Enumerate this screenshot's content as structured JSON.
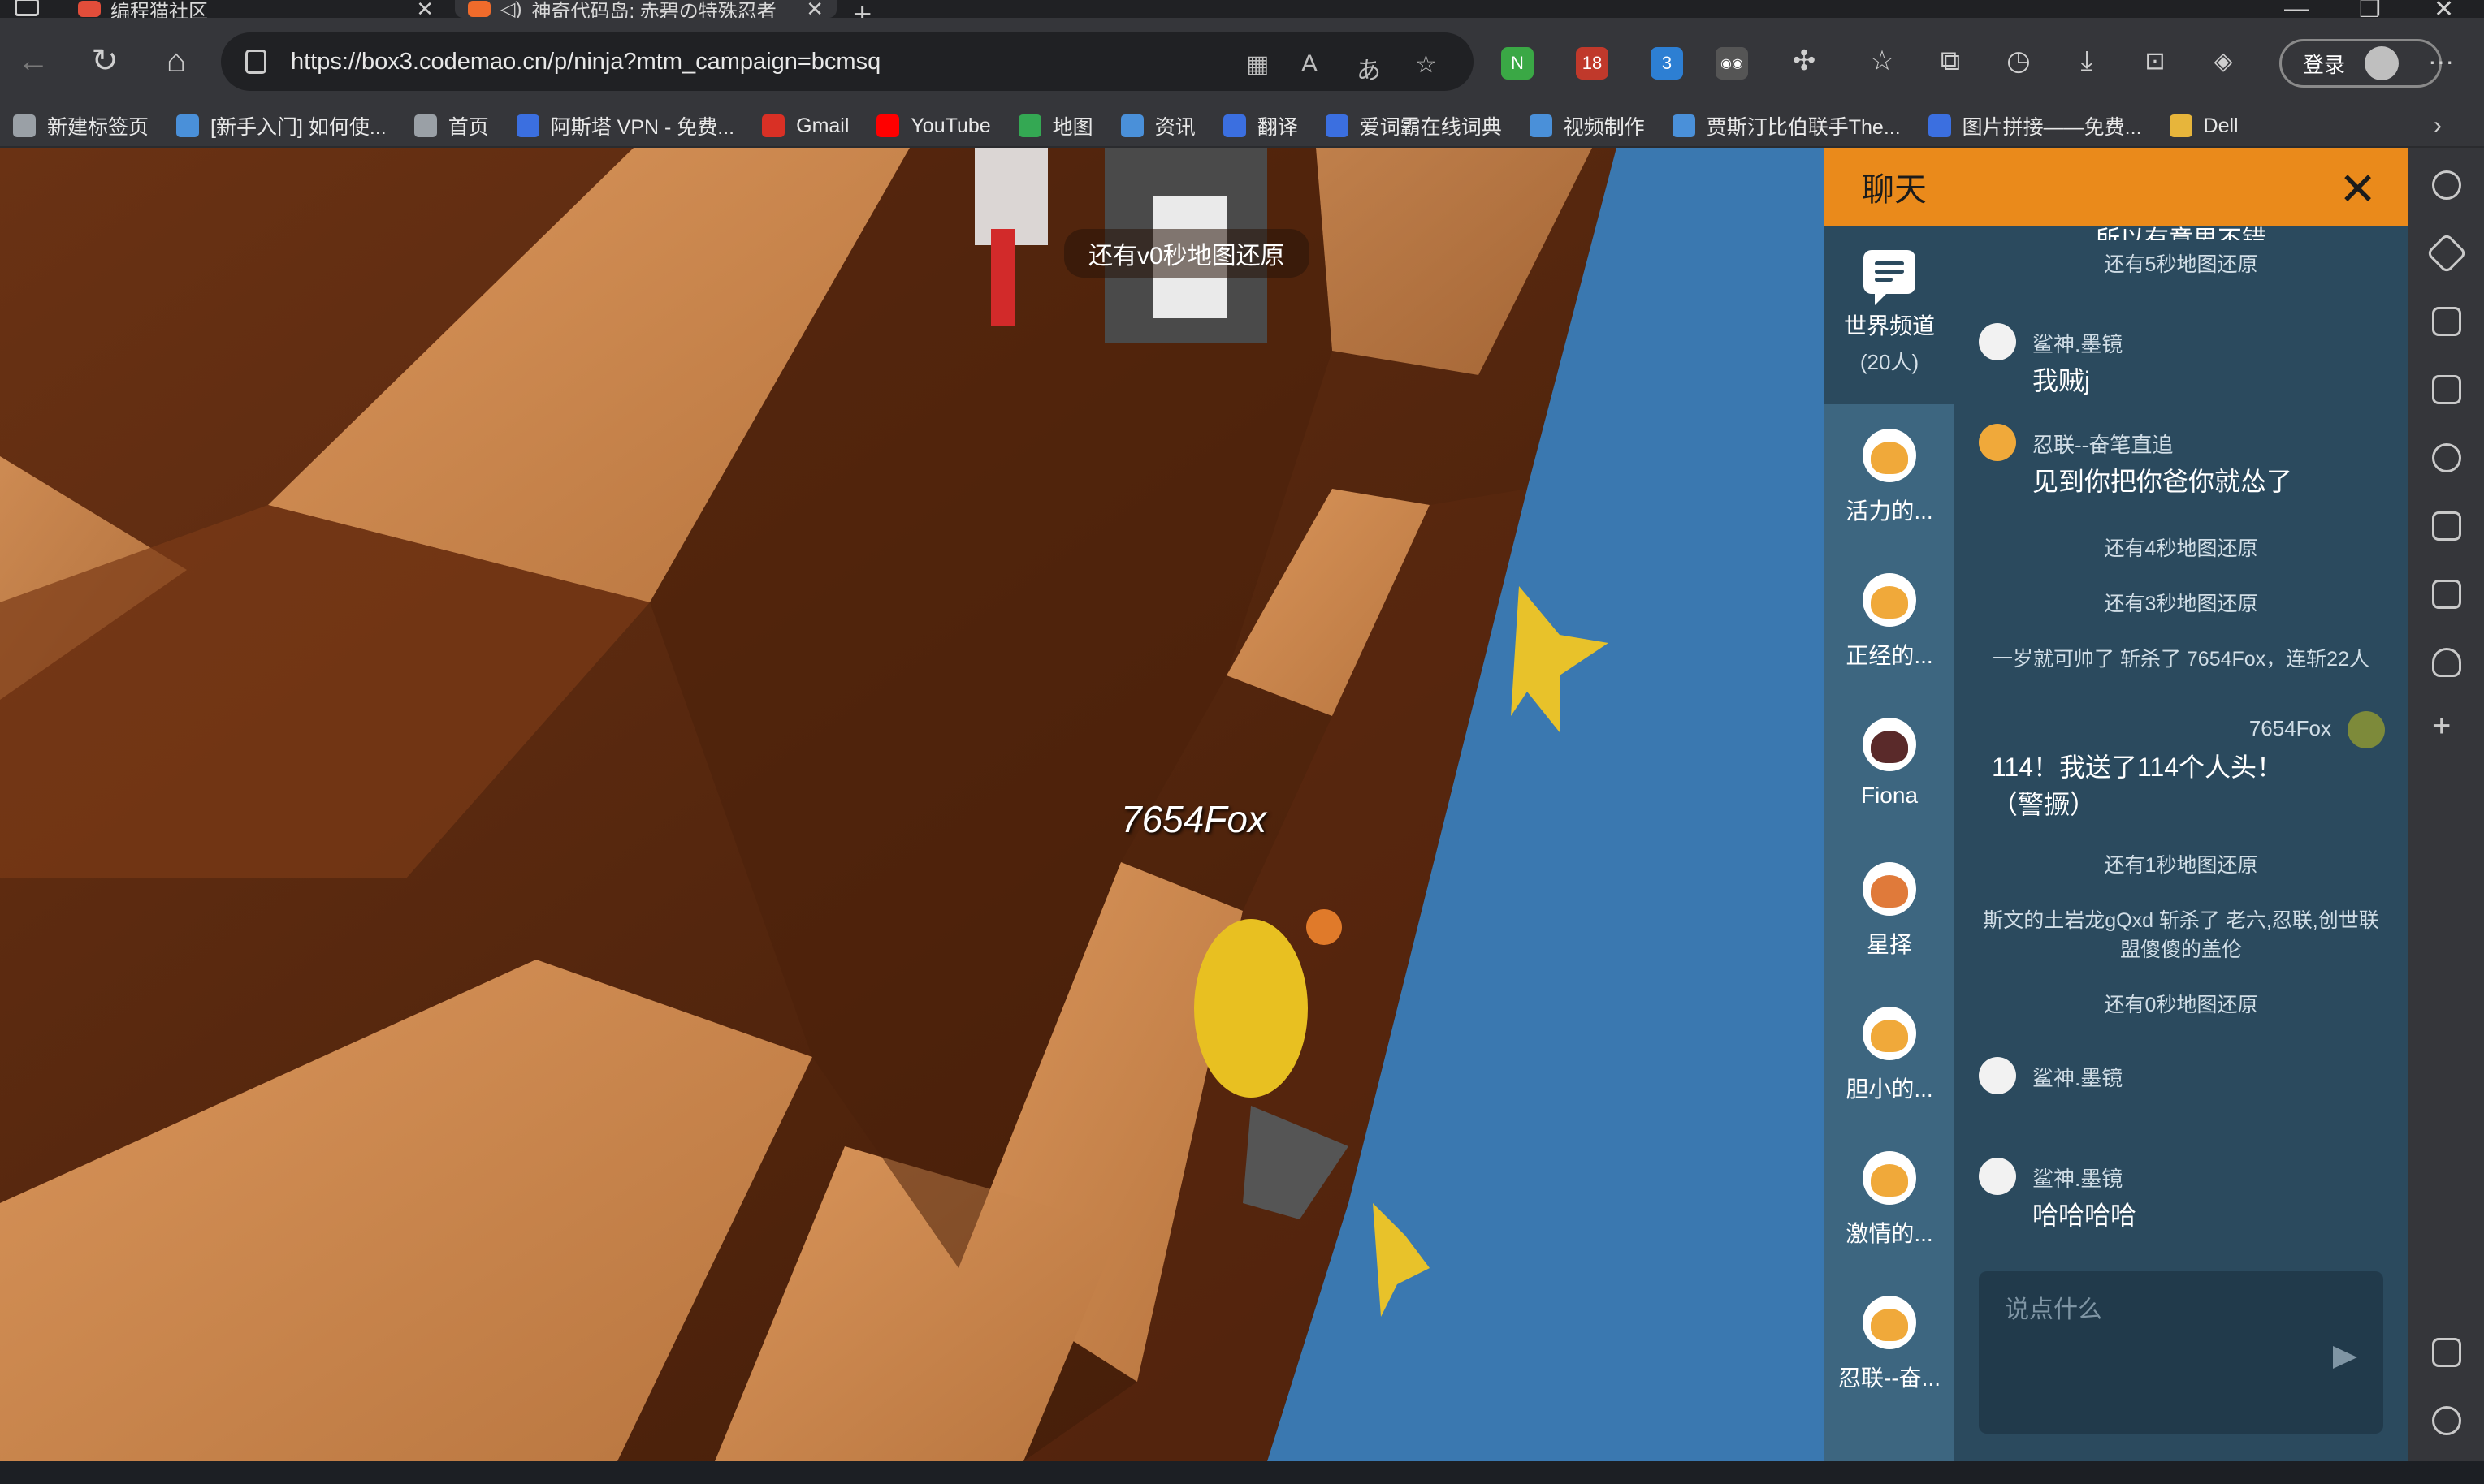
{
  "tabs": [
    {
      "title": "编程猫社区",
      "close": "✕"
    },
    {
      "title": "神奇代码岛: 赤碧の特殊忍者",
      "close": "✕"
    }
  ],
  "new_tab": "+",
  "window_controls": {
    "minimize": "—",
    "restore": "❐",
    "close": "✕"
  },
  "nav": {
    "back": "←",
    "reload": "↻",
    "home": "⌂"
  },
  "address": {
    "url": "https://box3.codemao.cn/p/ninja?mtm_campaign=bcmsq"
  },
  "extensions": [
    {
      "name": "n-extension-icon",
      "label": "N",
      "color": "#3aa845"
    },
    {
      "name": "ublock-icon",
      "label": "18",
      "color": "#c0392b"
    },
    {
      "name": "extension-3-icon",
      "label": "3",
      "color": "#2d7fd3"
    },
    {
      "name": "glasses-icon",
      "label": "◉◉",
      "color": "#555555"
    }
  ],
  "account": {
    "login_label": "登录",
    "more": "···"
  },
  "bookmarks": [
    {
      "label": "新建标签页",
      "color": "#9aa0a6"
    },
    {
      "label": "[新手入门] 如何使...",
      "color": "#4a90d9"
    },
    {
      "label": "首页",
      "color": "#9aa0a6"
    },
    {
      "label": "阿斯塔 VPN - 免费...",
      "color": "#3b6fe0"
    },
    {
      "label": "Gmail",
      "color": "#d93025"
    },
    {
      "label": "YouTube",
      "color": "#ff0000"
    },
    {
      "label": "地图",
      "color": "#34a853"
    },
    {
      "label": "资讯",
      "color": "#4a90d9"
    },
    {
      "label": "翻译",
      "color": "#3b6fe0"
    },
    {
      "label": "爱词霸在线词典",
      "color": "#3b6fe0"
    },
    {
      "label": "视频制作",
      "color": "#4a90d9"
    },
    {
      "label": "贾斯汀比伯联手The...",
      "color": "#4a90d9"
    },
    {
      "label": "图片拼接——免费...",
      "color": "#3b6fe0"
    },
    {
      "label": "Dell",
      "color": "#e7b53b"
    }
  ],
  "game": {
    "countdown_banner": "还有v0秒地图还原",
    "player_name": "7654Fox"
  },
  "chat": {
    "title": "聊天",
    "close": "✕",
    "world_channel": {
      "name": "世界频道",
      "count": "(20人)"
    },
    "friends": [
      {
        "name": "活力的...",
        "color": "#f0a93a"
      },
      {
        "name": "正经的...",
        "color": "#f0a93a"
      },
      {
        "name": "Fiona",
        "color": "#5a2a2a"
      },
      {
        "name": "星择",
        "color": "#e07a3a"
      },
      {
        "name": "胆小的...",
        "color": "#f0a93a"
      },
      {
        "name": "激情的...",
        "color": "#f0a93a"
      },
      {
        "name": "忍联--奋...",
        "color": "#f0a93a"
      }
    ],
    "partial_top": "所以有意思不错",
    "system": [
      "还有5秒地图还原",
      "还有4秒地图还原",
      "还有3秒地图还原",
      "一岁就可帅了 斩杀了 7654Fox，连斩22人",
      "还有1秒地图还原",
      "斯文的土岩龙gQxd 斩杀了 老六,忍联,创世联盟傻傻的盖伦",
      "还有0秒地图还原"
    ],
    "messages": [
      {
        "sender": "鲨神.墨镜",
        "text": "我贼j"
      },
      {
        "sender": "忍联--奋笔直追",
        "text": "见到你把你爸你就怂了"
      },
      {
        "sender": "7654Fox",
        "text": "114！我送了114个人头！（警撅）"
      },
      {
        "sender": "鲨神.墨镜",
        "text": ""
      },
      {
        "sender": "鲨神.墨镜",
        "text": "哈哈哈哈"
      }
    ],
    "input_placeholder": "说点什么"
  },
  "colors": {
    "chat_header": "#ea8a1b",
    "chat_bg": "#2b4a5e",
    "channel_bar": "#3d6680",
    "water": "#3a78b0"
  }
}
